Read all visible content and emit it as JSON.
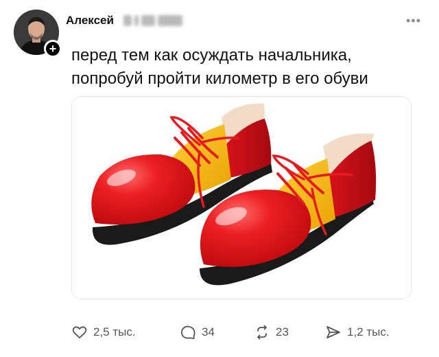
{
  "post": {
    "author": "Алексей",
    "text_line1": "перед тем как осуждать начальника,",
    "text_line2": "попробуй пройти километр в его обуви"
  },
  "actions": {
    "likes": "2,5 тыс.",
    "replies": "34",
    "reposts": "23",
    "shares": "1,2 тыс."
  },
  "icons": [
    "plus-icon",
    "more-icon",
    "heart-icon",
    "comment-icon",
    "repost-icon",
    "send-icon"
  ],
  "colors": {
    "shoe_red": "#e4161b",
    "shoe_yellow": "#f6b400",
    "sole": "#1a1a1a",
    "text": "#111111",
    "muted": "#555555"
  }
}
